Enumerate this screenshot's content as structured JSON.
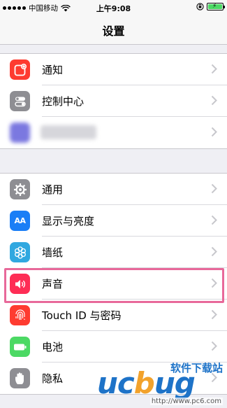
{
  "status_bar": {
    "carrier": "中国移动",
    "time": "上午9:08"
  },
  "nav": {
    "title": "设置"
  },
  "group1": [
    {
      "label": "通知",
      "icon": "notifications-icon",
      "color": "#fe3b30"
    },
    {
      "label": "控制中心",
      "icon": "control-center-icon",
      "color": "#8e8e93"
    },
    {
      "label": "",
      "icon": "blurred-app-icon",
      "color": "#7b78e0"
    }
  ],
  "group2": [
    {
      "label": "通用",
      "icon": "gear-icon",
      "color": "#8e8e93"
    },
    {
      "label": "显示与亮度",
      "icon": "display-brightness-icon",
      "color": "#1a7ef6"
    },
    {
      "label": "墙纸",
      "icon": "wallpaper-icon",
      "color": "#30a8e0"
    },
    {
      "label": "声音",
      "icon": "sound-icon",
      "color": "#fe2d55"
    },
    {
      "label": "Touch ID 与密码",
      "icon": "fingerprint-icon",
      "color": "#fe3b30"
    },
    {
      "label": "电池",
      "icon": "battery-icon",
      "color": "#4cd964"
    },
    {
      "label": "隐私",
      "icon": "privacy-hand-icon",
      "color": "#8e8e93"
    }
  ],
  "icon_text": {
    "display": "AA"
  },
  "watermark": {
    "cn": "软件下载站",
    "url": "http://www.pc6.com",
    "brand": "ucbug.cc"
  }
}
